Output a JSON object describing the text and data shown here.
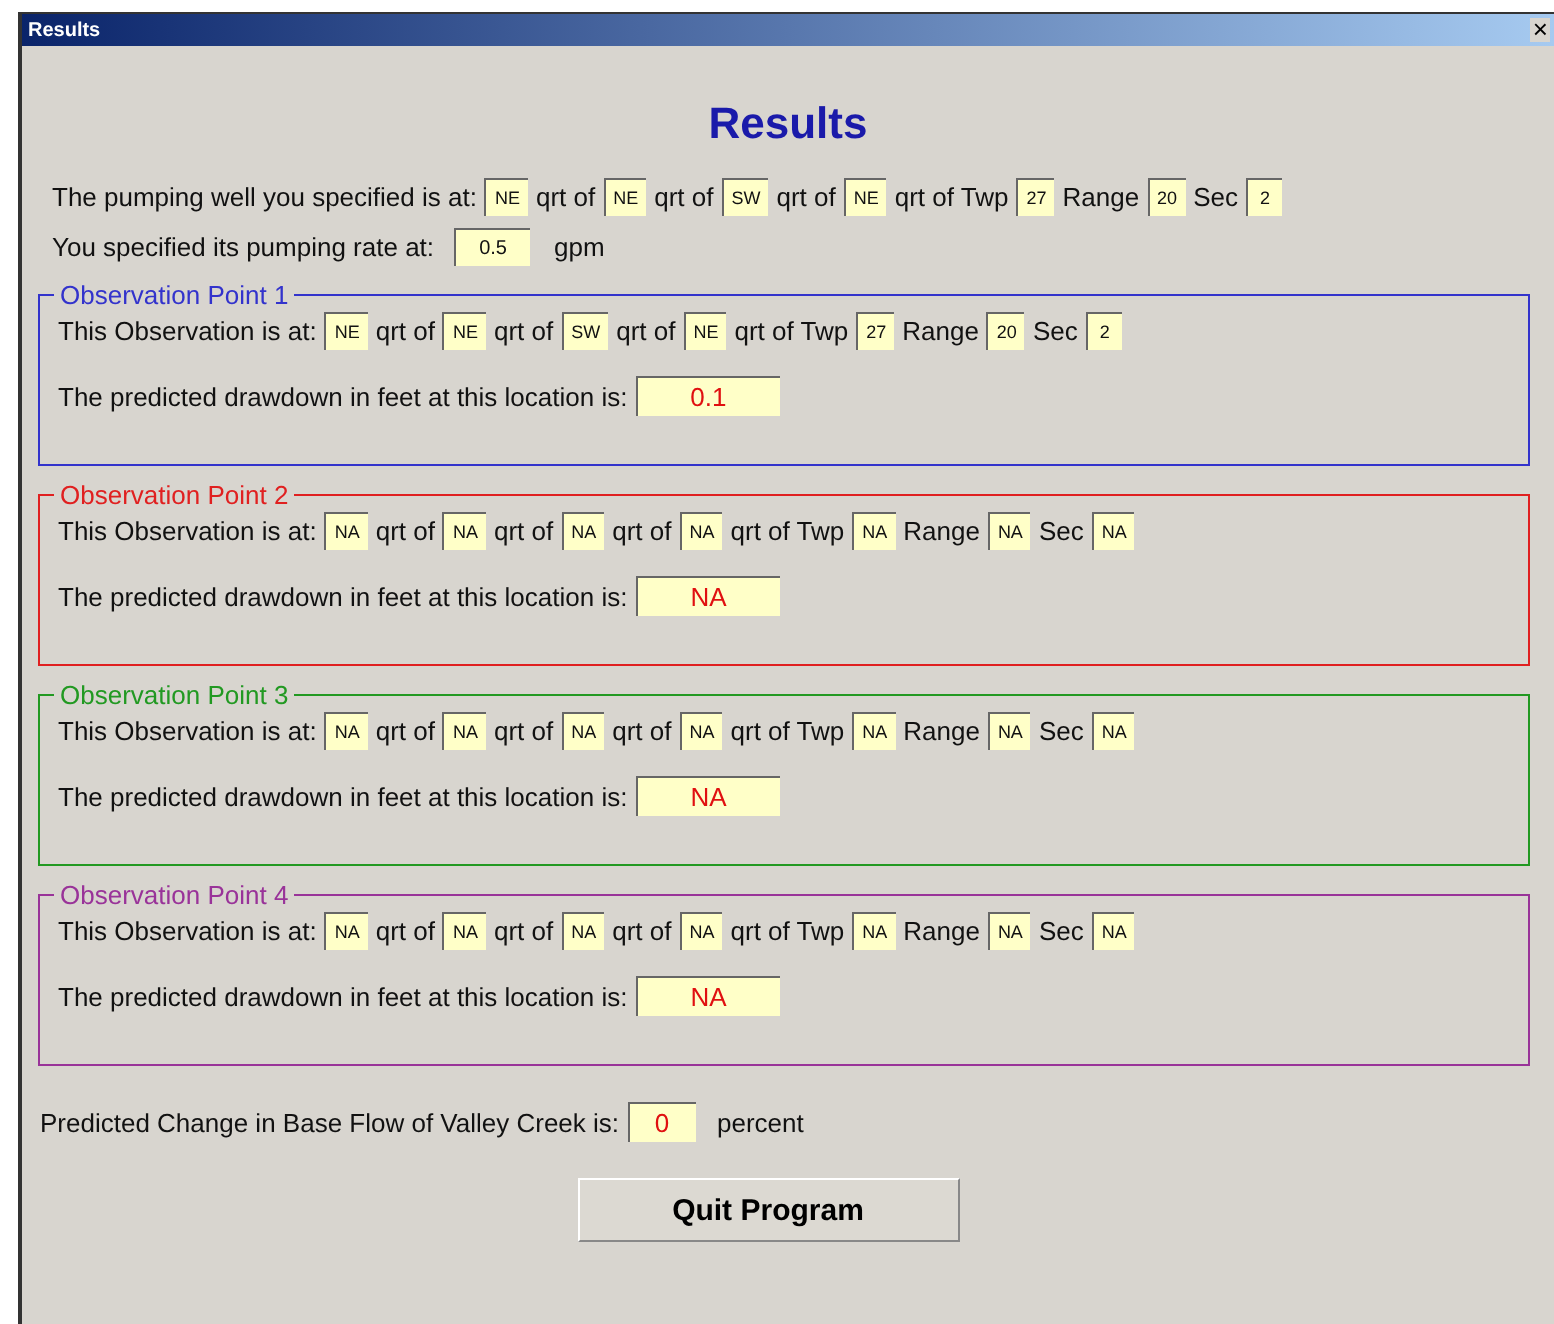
{
  "window": {
    "title": "Results",
    "close": "×"
  },
  "heading": "Results",
  "well": {
    "segments": [
      {
        "kind": "label",
        "text": "The pumping well you specified is at:"
      },
      {
        "kind": "field",
        "value": "NE"
      },
      {
        "kind": "label",
        "text": "qrt of"
      },
      {
        "kind": "field",
        "value": "NE"
      },
      {
        "kind": "label",
        "text": "qrt of"
      },
      {
        "kind": "field",
        "value": "SW"
      },
      {
        "kind": "label",
        "text": "qrt of"
      },
      {
        "kind": "field",
        "value": "NE"
      },
      {
        "kind": "label",
        "text": "qrt of Twp"
      },
      {
        "kind": "field",
        "value": "27"
      },
      {
        "kind": "label",
        "text": "Range"
      },
      {
        "kind": "field",
        "value": "20"
      },
      {
        "kind": "label",
        "text": "Sec"
      },
      {
        "kind": "field",
        "value": "2"
      }
    ]
  },
  "rate": {
    "label": "You specified its pumping rate at:",
    "value": "0.5",
    "unit": "gpm"
  },
  "observation_points": [
    {
      "title": "Observation Point 1",
      "color": "#3333cc",
      "segments": [
        {
          "kind": "label",
          "text": "This Observation is at:"
        },
        {
          "kind": "field",
          "value": "NE"
        },
        {
          "kind": "label",
          "text": "qrt of"
        },
        {
          "kind": "field",
          "value": "NE"
        },
        {
          "kind": "label",
          "text": "qrt of"
        },
        {
          "kind": "field",
          "value": "SW"
        },
        {
          "kind": "label",
          "text": "qrt of"
        },
        {
          "kind": "field",
          "value": "NE"
        },
        {
          "kind": "label",
          "text": "qrt of Twp"
        },
        {
          "kind": "field",
          "value": "27"
        },
        {
          "kind": "label",
          "text": "Range"
        },
        {
          "kind": "field",
          "value": "20"
        },
        {
          "kind": "label",
          "text": "Sec"
        },
        {
          "kind": "field",
          "value": "2"
        }
      ],
      "drawdown_label": "The predicted drawdown in feet at this location is:",
      "drawdown": "0.1"
    },
    {
      "title": "Observation Point 2",
      "color": "#e02020",
      "segments": [
        {
          "kind": "label",
          "text": "This Observation is at:"
        },
        {
          "kind": "field",
          "value": "NA"
        },
        {
          "kind": "label",
          "text": "qrt of"
        },
        {
          "kind": "field",
          "value": "NA"
        },
        {
          "kind": "label",
          "text": "qrt of"
        },
        {
          "kind": "field",
          "value": "NA"
        },
        {
          "kind": "label",
          "text": "qrt of"
        },
        {
          "kind": "field",
          "value": "NA"
        },
        {
          "kind": "label",
          "text": "qrt of Twp"
        },
        {
          "kind": "field",
          "value": "NA"
        },
        {
          "kind": "label",
          "text": "Range"
        },
        {
          "kind": "field",
          "value": "NA"
        },
        {
          "kind": "label",
          "text": "Sec"
        },
        {
          "kind": "field",
          "value": "NA"
        }
      ],
      "drawdown_label": "The predicted drawdown in feet at this location is:",
      "drawdown": "NA"
    },
    {
      "title": "Observation Point 3",
      "color": "#229922",
      "segments": [
        {
          "kind": "label",
          "text": "This Observation is at:"
        },
        {
          "kind": "field",
          "value": "NA"
        },
        {
          "kind": "label",
          "text": "qrt of"
        },
        {
          "kind": "field",
          "value": "NA"
        },
        {
          "kind": "label",
          "text": "qrt of"
        },
        {
          "kind": "field",
          "value": "NA"
        },
        {
          "kind": "label",
          "text": "qrt of"
        },
        {
          "kind": "field",
          "value": "NA"
        },
        {
          "kind": "label",
          "text": "qrt of Twp"
        },
        {
          "kind": "field",
          "value": "NA"
        },
        {
          "kind": "label",
          "text": "Range"
        },
        {
          "kind": "field",
          "value": "NA"
        },
        {
          "kind": "label",
          "text": "Sec"
        },
        {
          "kind": "field",
          "value": "NA"
        }
      ],
      "drawdown_label": "The predicted drawdown in feet at this location is:",
      "drawdown": "NA"
    },
    {
      "title": "Observation Point 4",
      "color": "#993399",
      "segments": [
        {
          "kind": "label",
          "text": "This Observation is at:"
        },
        {
          "kind": "field",
          "value": "NA"
        },
        {
          "kind": "label",
          "text": "qrt of"
        },
        {
          "kind": "field",
          "value": "NA"
        },
        {
          "kind": "label",
          "text": "qrt of"
        },
        {
          "kind": "field",
          "value": "NA"
        },
        {
          "kind": "label",
          "text": "qrt of"
        },
        {
          "kind": "field",
          "value": "NA"
        },
        {
          "kind": "label",
          "text": "qrt of Twp"
        },
        {
          "kind": "field",
          "value": "NA"
        },
        {
          "kind": "label",
          "text": "Range"
        },
        {
          "kind": "field",
          "value": "NA"
        },
        {
          "kind": "label",
          "text": "Sec"
        },
        {
          "kind": "field",
          "value": "NA"
        }
      ],
      "drawdown_label": "The predicted drawdown in feet at this location is:",
      "drawdown": "NA"
    }
  ],
  "base_flow": {
    "label": "Predicted Change in Base Flow of Valley Creek is:",
    "value": "0",
    "unit": "percent"
  },
  "quit_button": "Quit Program"
}
